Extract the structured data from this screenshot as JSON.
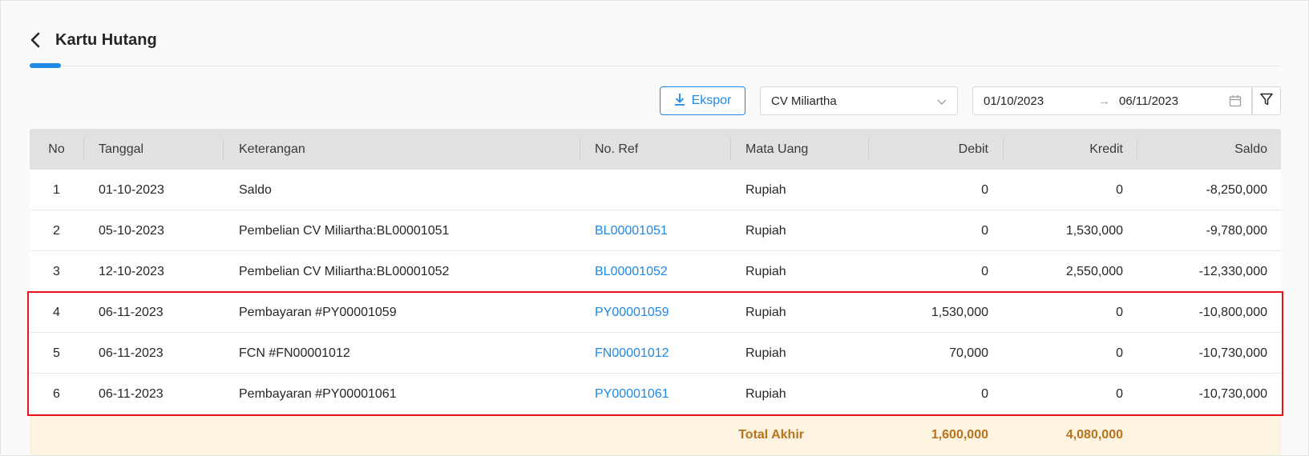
{
  "page": {
    "title": "Kartu Hutang",
    "back_icon": "chevron-left-icon"
  },
  "toolbar": {
    "export_label": "Ekspor",
    "export_icon": "download-icon",
    "supplier_value": "CV Miliartha",
    "date_start": "01/10/2023",
    "date_separator": "→",
    "date_end": "06/11/2023",
    "calendar_icon": "calendar-icon",
    "filter_icon": "filter-icon"
  },
  "table": {
    "headers": {
      "no": "No",
      "tanggal": "Tanggal",
      "keterangan": "Keterangan",
      "ref": "No. Ref",
      "mata_uang": "Mata Uang",
      "debit": "Debit",
      "kredit": "Kredit",
      "saldo": "Saldo"
    },
    "rows": [
      {
        "no": "1",
        "tanggal": "01-10-2023",
        "keterangan": "Saldo",
        "ref": "",
        "mata_uang": "Rupiah",
        "debit": "0",
        "kredit": "0",
        "saldo": "-8,250,000"
      },
      {
        "no": "2",
        "tanggal": "05-10-2023",
        "keterangan": "Pembelian CV Miliartha:BL00001051",
        "ref": "BL00001051",
        "mata_uang": "Rupiah",
        "debit": "0",
        "kredit": "1,530,000",
        "saldo": "-9,780,000"
      },
      {
        "no": "3",
        "tanggal": "12-10-2023",
        "keterangan": "Pembelian CV Miliartha:BL00001052",
        "ref": "BL00001052",
        "mata_uang": "Rupiah",
        "debit": "0",
        "kredit": "2,550,000",
        "saldo": "-12,330,000"
      },
      {
        "no": "4",
        "tanggal": "06-11-2023",
        "keterangan": "Pembayaran #PY00001059",
        "ref": "PY00001059",
        "mata_uang": "Rupiah",
        "debit": "1,530,000",
        "kredit": "0",
        "saldo": "-10,800,000"
      },
      {
        "no": "5",
        "tanggal": "06-11-2023",
        "keterangan": "FCN #FN00001012",
        "ref": "FN00001012",
        "mata_uang": "Rupiah",
        "debit": "70,000",
        "kredit": "0",
        "saldo": "-10,730,000"
      },
      {
        "no": "6",
        "tanggal": "06-11-2023",
        "keterangan": "Pembayaran #PY00001061",
        "ref": "PY00001061",
        "mata_uang": "Rupiah",
        "debit": "0",
        "kredit": "0",
        "saldo": "-10,730,000"
      }
    ],
    "total": {
      "label": "Total Akhir",
      "debit": "1,600,000",
      "kredit": "4,080,000"
    }
  },
  "colors": {
    "accent": "#1e88e5",
    "highlight_border": "#e8141c",
    "total_background": "#fdf3e1",
    "total_text": "#b8731c"
  }
}
